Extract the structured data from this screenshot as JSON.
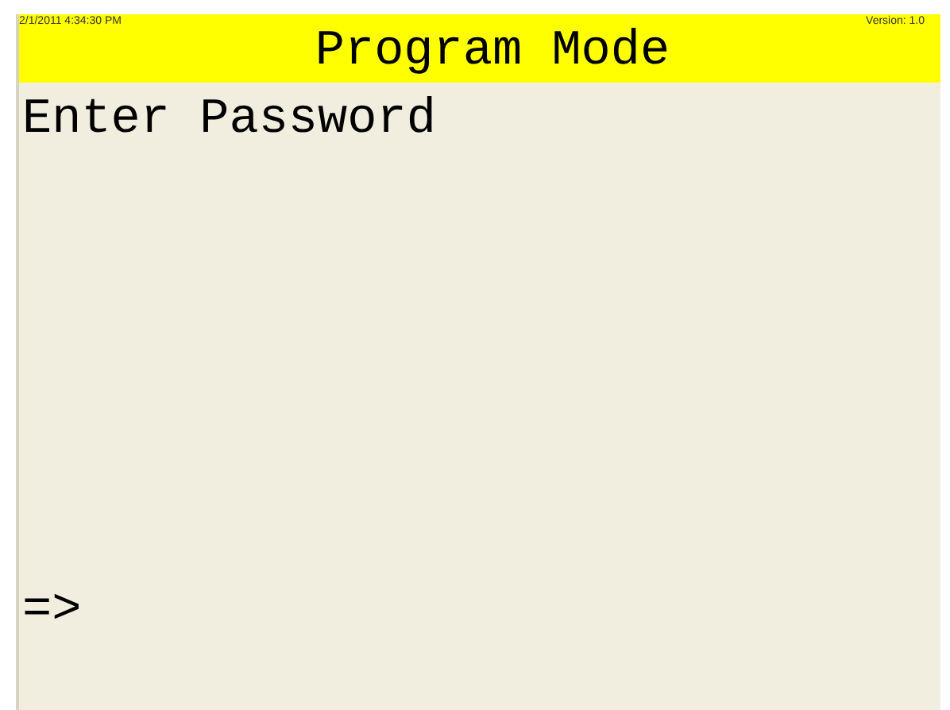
{
  "header": {
    "timestamp": "2/1/2011 4:34:30 PM",
    "title": "Program Mode",
    "version": "Version: 1.0"
  },
  "prompt": "Enter Password",
  "input_prompt": "=>"
}
